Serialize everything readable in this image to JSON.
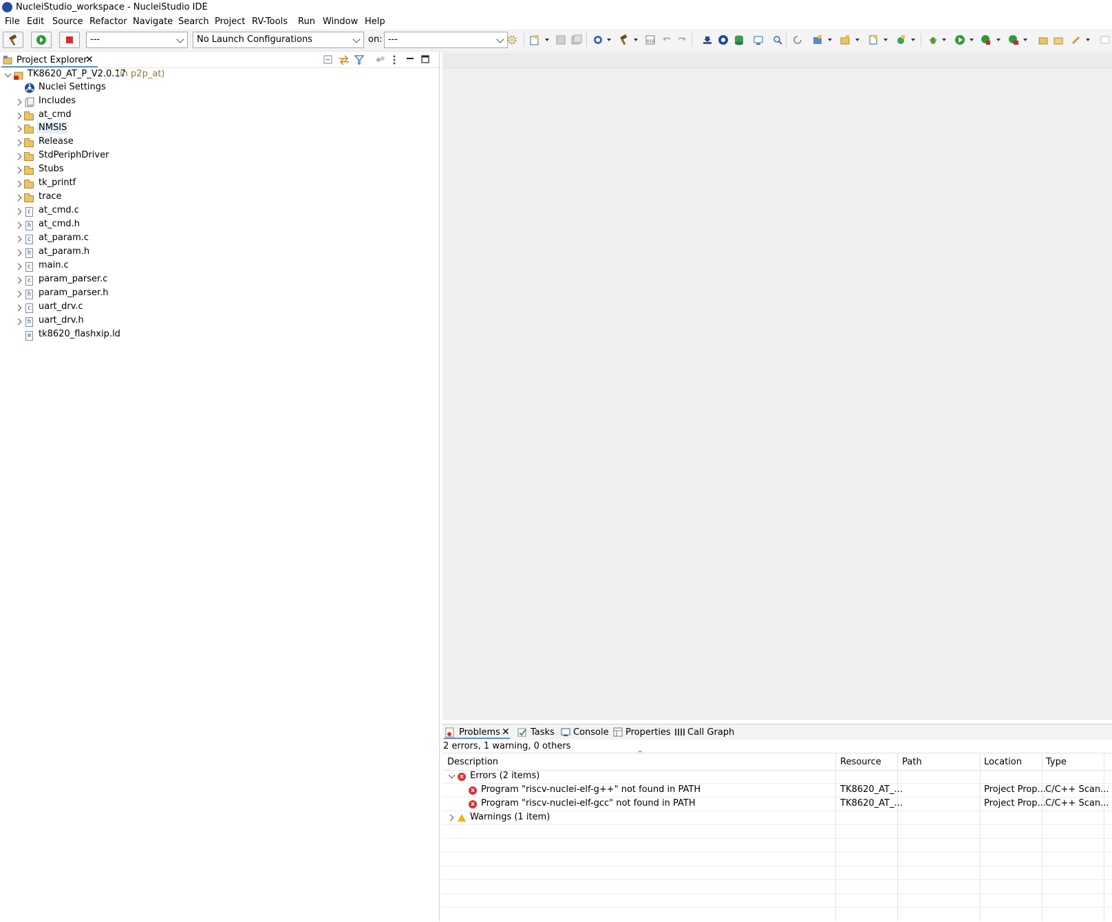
{
  "window": {
    "title": "NucleiStudio_workspace - NucleiStudio IDE"
  },
  "menu": [
    "File",
    "Edit",
    "Source",
    "Refactor",
    "Navigate",
    "Search",
    "Project",
    "RV-Tools",
    "Run",
    "Window",
    "Help"
  ],
  "toolbar": {
    "launch_mode_value": "---",
    "launch_config_value": "No Launch Configurations",
    "on_label": "on:",
    "launch_target_value": "---"
  },
  "project_explorer": {
    "tab_label": "Project Explorer",
    "project_name": "TK8620_AT_P_V2.0.17",
    "project_location": "(in p2p_at)",
    "items": [
      {
        "label": "Nuclei Settings",
        "icon": "nuclei-settings-icon"
      },
      {
        "label": "Includes",
        "icon": "includes-icon"
      },
      {
        "label": "at_cmd",
        "icon": "folder-icon"
      },
      {
        "label": "NMSIS",
        "icon": "folder-icon"
      },
      {
        "label": "Release",
        "icon": "folder-icon"
      },
      {
        "label": "StdPeriphDriver",
        "icon": "folder-icon"
      },
      {
        "label": "Stubs",
        "icon": "folder-icon"
      },
      {
        "label": "tk_printf",
        "icon": "folder-icon"
      },
      {
        "label": "trace",
        "icon": "folder-icon"
      },
      {
        "label": "at_cmd.c",
        "icon": "c-file-icon"
      },
      {
        "label": "at_cmd.h",
        "icon": "h-file-icon"
      },
      {
        "label": "at_param.c",
        "icon": "c-file-icon"
      },
      {
        "label": "at_param.h",
        "icon": "h-file-icon"
      },
      {
        "label": "main.c",
        "icon": "c-file-icon"
      },
      {
        "label": "param_parser.c",
        "icon": "c-file-icon"
      },
      {
        "label": "param_parser.h",
        "icon": "h-file-icon"
      },
      {
        "label": "uart_drv.c",
        "icon": "c-file-icon"
      },
      {
        "label": "uart_drv.h",
        "icon": "h-file-icon"
      },
      {
        "label": "tk8620_flashxip.ld",
        "icon": "linker-file-icon"
      }
    ]
  },
  "problems_view": {
    "tabs": [
      "Problems",
      "Tasks",
      "Console",
      "Properties",
      "Call Graph"
    ],
    "summary": "2 errors, 1 warning, 0 others",
    "columns": [
      "Description",
      "Resource",
      "Path",
      "Location",
      "Type"
    ],
    "errors_group": "Errors (2 items)",
    "warnings_group": "Warnings (1 item)",
    "rows": [
      {
        "description": "Program \"riscv-nuclei-elf-g++\" not found in PATH",
        "resource": "TK8620_AT_...",
        "path": "",
        "location": "Project Prop...",
        "type": "C/C++ Scan..."
      },
      {
        "description": "Program \"riscv-nuclei-elf-gcc\" not found in PATH",
        "resource": "TK8620_AT_...",
        "path": "",
        "location": "Project Prop...",
        "type": "C/C++ Scan..."
      }
    ]
  },
  "colors": {
    "error": "#d9302f",
    "warning": "#f0b400",
    "tab_accent": "#5a93d6",
    "project_location": "#8a7a3a"
  }
}
